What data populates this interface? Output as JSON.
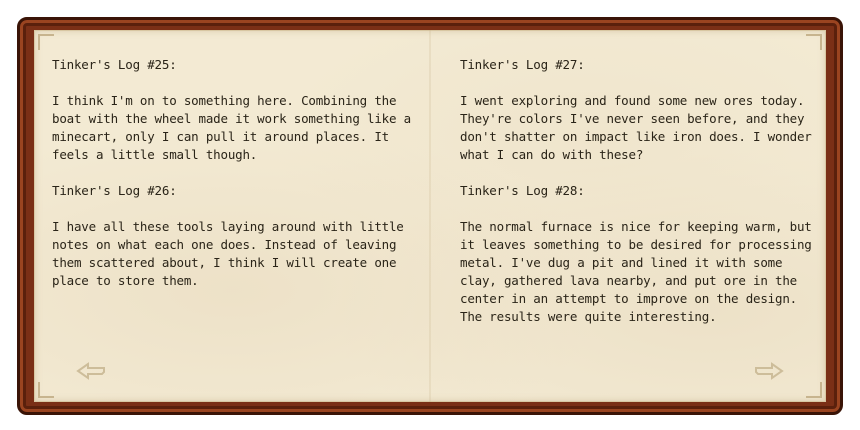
{
  "book": {
    "left_page": {
      "entries": [
        {
          "title": "Tinker's Log #25:",
          "body": "I think I'm on to something here. Combining the boat with the wheel made it work something like a minecart, only I can pull it around places. It feels a little small though."
        },
        {
          "title": "Tinker's Log #26:",
          "body": "I have all these tools laying around with little notes on what each one does. Instead of leaving them scattered about, I think I will create one place to store them."
        }
      ]
    },
    "right_page": {
      "entries": [
        {
          "title": "Tinker's Log #27:",
          "body": "I went exploring and found some new ores today. They're colors I've never seen before, and they don't shatter on impact like iron does. I wonder what I can do with these?"
        },
        {
          "title": "Tinker's Log #28:",
          "body": "The normal furnace is nice for keeping warm, but it leaves something to be desired for processing metal. I've dug a pit and lined it with some clay, gathered lava nearby, and put ore in the center in an attempt to improve on the design. The results were quite interesting."
        }
      ]
    },
    "navigation": {
      "prev_icon": "arrow-left-icon",
      "next_icon": "arrow-right-icon"
    },
    "colors": {
      "cover": "#7a2f16",
      "cover_outline": "#3a1407",
      "page": "#f3ead3",
      "text": "#2a2418",
      "arrow": "#cdbd9a"
    }
  }
}
